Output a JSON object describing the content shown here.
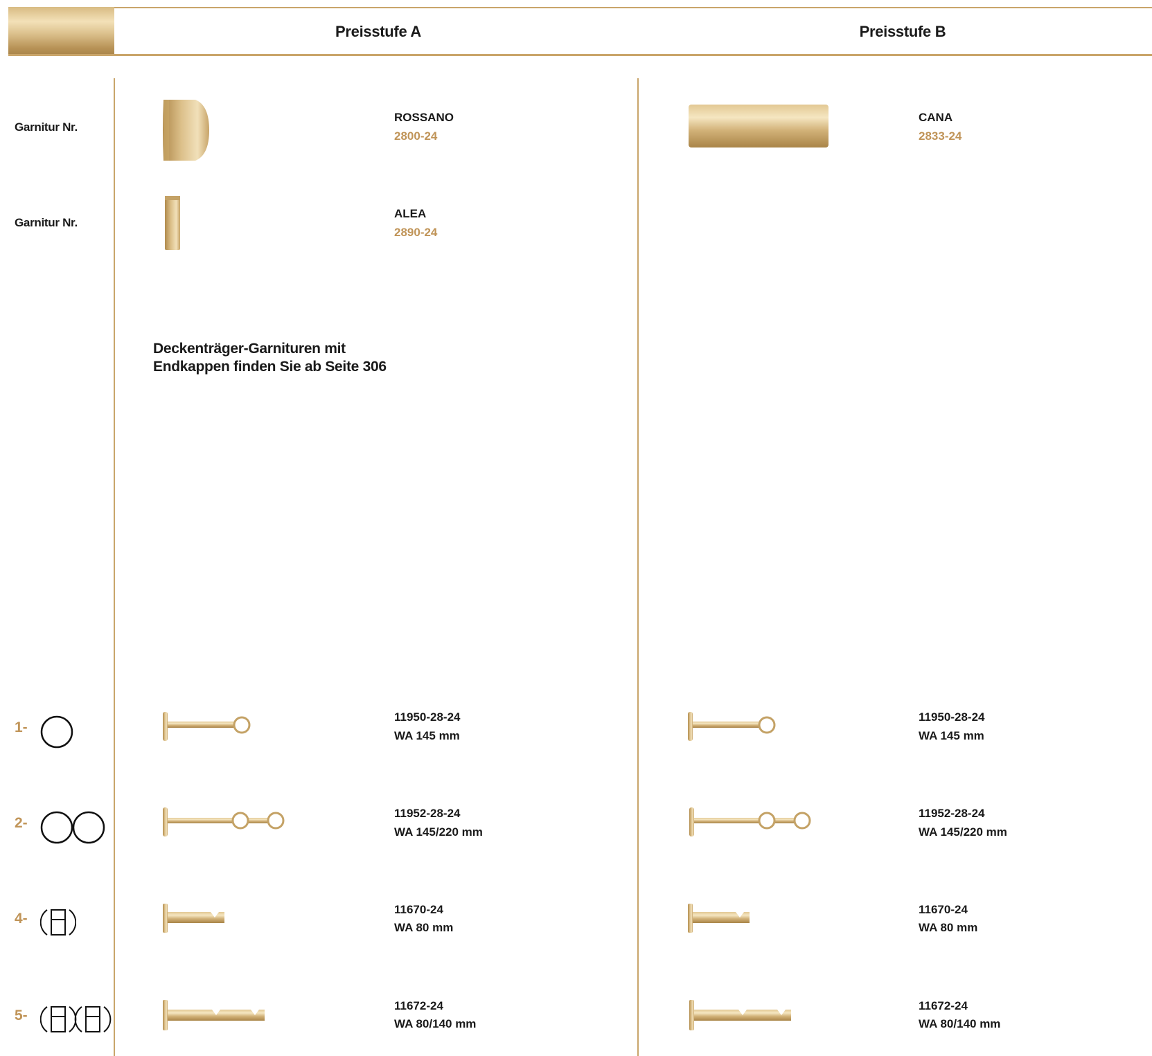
{
  "header": {
    "col_a_title": "Preisstufe A",
    "col_b_title": "Preisstufe B"
  },
  "rows_left_labels": {
    "garnitur_1": "Garnitur Nr.",
    "garnitur_2": "Garnitur Nr."
  },
  "col_a": {
    "finial_1": {
      "name": "ROSSANO",
      "code": "2800-24"
    },
    "finial_2": {
      "name": "ALEA",
      "code": "2890-24"
    },
    "note_line1": "Deckenträger-Garnituren mit",
    "note_line2": "Endkappen finden Sie ab Seite 306"
  },
  "col_b": {
    "finial_1": {
      "name": "CANA",
      "code": "2833-24"
    }
  },
  "brackets": [
    {
      "num": "1-",
      "a_code": "11950-28-24",
      "a_wa": "WA 145 mm",
      "b_code": "11950-28-24",
      "b_wa": "WA 145 mm"
    },
    {
      "num": "2-",
      "a_code": "11952-28-24",
      "a_wa": "WA 145/220 mm",
      "b_code": "11952-28-24",
      "b_wa": "WA 145/220 mm"
    },
    {
      "num": "4-",
      "a_code": "11670-24",
      "a_wa": "WA 80 mm",
      "b_code": "11670-24",
      "b_wa": "WA 80 mm"
    },
    {
      "num": "5-",
      "a_code": "11672-24",
      "a_wa": "WA 80/140 mm",
      "b_code": "11672-24",
      "b_wa": "WA 80/140 mm"
    }
  ],
  "colors": {
    "gold": "#c9a56a",
    "gold_text": "#c09458"
  }
}
